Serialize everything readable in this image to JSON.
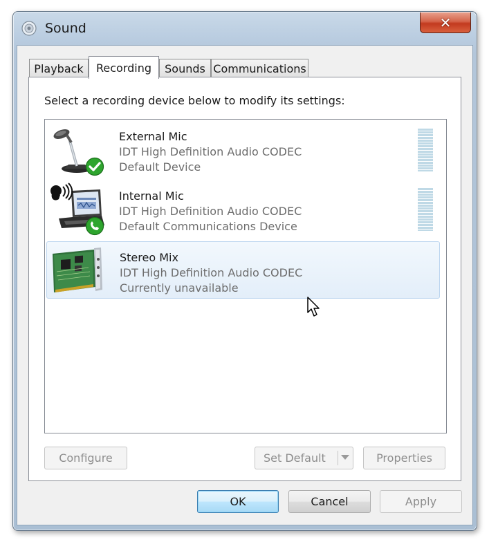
{
  "window": {
    "title": "Sound",
    "icon": "speaker-icon",
    "close_icon": "close-icon",
    "close_glyph": "✕"
  },
  "tabs": [
    {
      "label": "Playback",
      "active": false
    },
    {
      "label": "Recording",
      "active": true
    },
    {
      "label": "Sounds",
      "active": false
    },
    {
      "label": "Communications",
      "active": false
    }
  ],
  "panel": {
    "instruction": "Select a recording device below to modify its settings:",
    "devices": [
      {
        "name": "External Mic",
        "driver": "IDT High Definition Audio CODEC",
        "status": "Default Device",
        "icon": "microphone-icon",
        "badge": "default-check-icon",
        "selected": false
      },
      {
        "name": "Internal Mic",
        "driver": "IDT High Definition Audio CODEC",
        "status": "Default Communications Device",
        "icon": "laptop-headset-icon",
        "badge": "communications-phone-icon",
        "selected": false
      },
      {
        "name": "Stereo Mix",
        "driver": "IDT High Definition Audio CODEC",
        "status": "Currently unavailable",
        "icon": "sound-card-icon",
        "selected": true
      }
    ],
    "buttons": {
      "configure": "Configure",
      "set_default": "Set Default",
      "properties": "Properties"
    }
  },
  "footer": {
    "ok": "OK",
    "cancel": "Cancel",
    "apply": "Apply"
  },
  "colors": {
    "selection_bg": "#e3eef9",
    "selection_border": "#bcd5ef",
    "level_meter": "#bfd9e6",
    "close_button": "#c23a1f"
  }
}
